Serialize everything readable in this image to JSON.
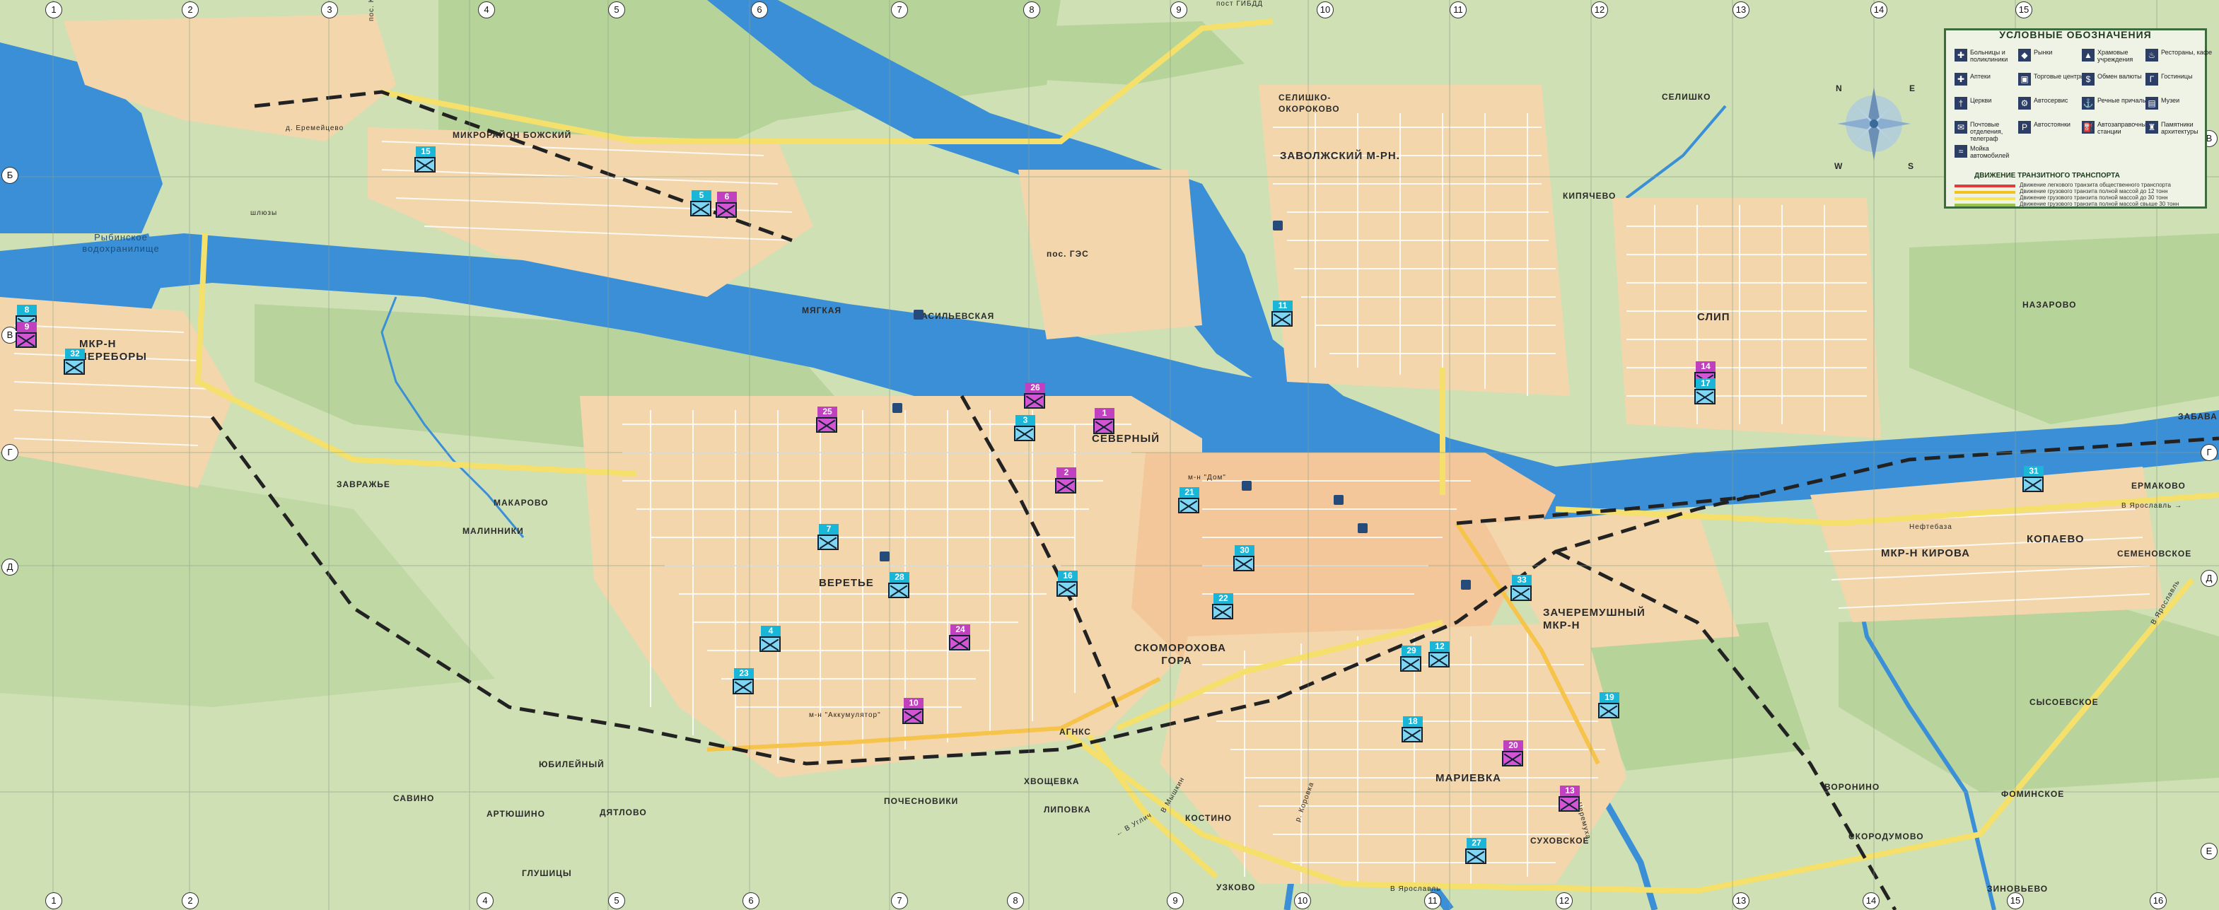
{
  "legend": {
    "title": "УСЛОВНЫЕ ОБОЗНАЧЕНИЯ",
    "items": [
      {
        "icon": "hospital-icon",
        "label": "Больницы и поликлиники"
      },
      {
        "icon": "market-icon",
        "label": "Рынки"
      },
      {
        "icon": "church-icon",
        "label": "Храмовые учреждения"
      },
      {
        "icon": "restaurant-icon",
        "label": "Рестораны, кафе"
      },
      {
        "icon": "pharmacy-icon",
        "label": "Аптеки"
      },
      {
        "icon": "shopping-icon",
        "label": "Торговые центры"
      },
      {
        "icon": "exchange-icon",
        "label": "Обмен валюты"
      },
      {
        "icon": "hotel-icon",
        "label": "Гостиницы"
      },
      {
        "icon": "church2-icon",
        "label": "Церкви"
      },
      {
        "icon": "autoservice-icon",
        "label": "Автосервис"
      },
      {
        "icon": "port-icon",
        "label": "Речные причалы"
      },
      {
        "icon": "museum-icon",
        "label": "Музеи"
      },
      {
        "icon": "post-icon",
        "label": "Почтовые отделения, телеграф"
      },
      {
        "icon": "parking-icon",
        "label": "Автостоянки"
      },
      {
        "icon": "gas-icon",
        "label": "Автозаправочные станции"
      },
      {
        "icon": "monument-icon",
        "label": "Памятники архитектуры"
      },
      {
        "icon": "car-wash-icon",
        "label": "Мойка автомобилей"
      }
    ],
    "transit_title": "ДВИЖЕНИЕ ТРАНЗИТНОГО ТРАНСПОРТА",
    "transit": [
      "Движение легкового транзита общественного транспорта",
      "Движение грузового транзита полной массой до 12 тонн",
      "Движение грузового транзита полной массой до 30 тонн",
      "Движение грузового транзита полной массой свыше 30 тонн"
    ],
    "colors": {
      "transit1": "#e23b3b",
      "transit2": "#f2c21a",
      "transit3": "#f7e55a",
      "transit4": "#9bc34a"
    }
  },
  "compass": {
    "n": "N",
    "e": "E",
    "s": "S",
    "w": "W"
  },
  "grid_top": [
    "1",
    "2",
    "3",
    "4",
    "5",
    "6",
    "7",
    "8",
    "9",
    "10",
    "11",
    "12",
    "13",
    "14",
    "15"
  ],
  "grid_bottom": [
    "1",
    "2",
    "3",
    "4",
    "5",
    "6",
    "7",
    "8",
    "9",
    "10",
    "11",
    "12",
    "13",
    "14",
    "15",
    "16"
  ],
  "grid_left": [
    "Б",
    "В",
    "Г",
    "Д"
  ],
  "grid_right": [
    "В",
    "Г",
    "Д",
    "Е"
  ],
  "places": {
    "rybinsk_reservoir": "Рыбинское водохранилище",
    "mkr_perebory": "МКР-Н ПЕРЕБОРЫ",
    "mikrorayon_bozhsky": "МИКРОРАЙОН БОЖСКИЙ",
    "d_eremeitsevo": "д. Еремейцево",
    "pos_kamenniki": "пос. Каменники",
    "pos_ges": "пос. ГЭС",
    "myagkaya": "МЯГКАЯ",
    "vasilevskaya": "ВАСИЛЬЕВСКАЯ",
    "zavrazhe": "ЗАВРАЖЬЕ",
    "makarovo": "МАКАРОВО",
    "malinniki": "МАЛИННИКИ",
    "severny": "СЕВЕРНЫЙ",
    "veretye": "ВЕРЕТЬЕ",
    "skomorokhova_gora": "СКОМОРОХОВА ГОРА",
    "zavolzhsky": "ЗАВОЛЖСКИЙ М-РН.",
    "selishko_okorokovo": "СЕЛИШКО-ОКОРОКОВО",
    "selishko": "СЕЛИШКО",
    "kipyachevo": "КИПЯЧЕВО",
    "slip": "СЛИП",
    "nazarovo": "НАЗАРОВО",
    "zababa": "ЗАБАВА",
    "ermakovo": "ЕРМАКОВО",
    "kopaevo": "КОПАЕВО",
    "mkr_kirova": "МКР-Н КИРОВА",
    "neftebaza": "Нефтебаза",
    "semenovskoe": "СЕМЕНОВСКОЕ",
    "zacheremushny": "ЗАЧЕРЕМУШНЫЙ МКР-Н",
    "marievka": "МАРИЕВКА",
    "sukhovskoe": "СУХОВСКОЕ",
    "sysoevskoe": "СЫСОЕВСКОЕ",
    "voronino": "ВОРОНИНО",
    "fominskoe": "ФОМИНСКОЕ",
    "skorodumovo": "СКОРОДУМОВО",
    "zinovevo": "ЗИНОВЬЕВО",
    "khvoshchevka": "ХВОЩЕВКА",
    "lipovka": "ЛИПОВКА",
    "kostino": "КОСТИНО",
    "uzkovo": "УЗКОВО",
    "pochesnoviki": "ПОЧЕСНОВИКИ",
    "agnks": "АГНКС",
    "yubileyny": "ЮБИЛЕЙНЫЙ",
    "savino": "САВИНО",
    "artyushino": "АРТЮШИНО",
    "dyatlovo": "ДЯТЛОВО",
    "glushitsy": "ГЛУШИЦЫ",
    "to_yaroslavl_1": "В Ярославль →",
    "to_yaroslavl_2": "В Ярославль",
    "to_yaroslavl_3": "В Ярославль",
    "to_uglich": "← В Углич",
    "to_myshkin": "В Мышкин",
    "shlyuzy": "шлюзы",
    "river_volga": "р. Волга",
    "river_cheremukha": "р. Черемуха",
    "river_koroshka": "р. Коровка",
    "akkumulyator": "м-н \"Аккумулятор\"",
    "dom": "м-н \"Дом\"",
    "pos_giidd": "пост ГИБДД"
  },
  "post_offices": [
    {
      "num": "15",
      "color": "blue"
    },
    {
      "num": "5",
      "color": "blue"
    },
    {
      "num": "6",
      "color": "pink"
    },
    {
      "num": "8",
      "color": "blue"
    },
    {
      "num": "9",
      "color": "pink"
    },
    {
      "num": "32",
      "color": "blue"
    },
    {
      "num": "11",
      "color": "blue"
    },
    {
      "num": "25",
      "color": "pink"
    },
    {
      "num": "26",
      "color": "pink"
    },
    {
      "num": "3",
      "color": "blue"
    },
    {
      "num": "1",
      "color": "pink"
    },
    {
      "num": "2",
      "color": "pink"
    },
    {
      "num": "21",
      "color": "blue"
    },
    {
      "num": "7",
      "color": "blue"
    },
    {
      "num": "28",
      "color": "blue"
    },
    {
      "num": "30",
      "color": "blue"
    },
    {
      "num": "16",
      "color": "blue"
    },
    {
      "num": "22",
      "color": "blue"
    },
    {
      "num": "4",
      "color": "blue"
    },
    {
      "num": "24",
      "color": "pink"
    },
    {
      "num": "23",
      "color": "blue"
    },
    {
      "num": "10",
      "color": "pink"
    },
    {
      "num": "14",
      "color": "pink"
    },
    {
      "num": "17",
      "color": "blue"
    },
    {
      "num": "31",
      "color": "blue"
    },
    {
      "num": "33",
      "color": "blue"
    },
    {
      "num": "29",
      "color": "blue"
    },
    {
      "num": "12",
      "color": "blue"
    },
    {
      "num": "19",
      "color": "blue"
    },
    {
      "num": "18",
      "color": "blue"
    },
    {
      "num": "20",
      "color": "pink"
    },
    {
      "num": "13",
      "color": "pink"
    },
    {
      "num": "27",
      "color": "blue"
    }
  ]
}
